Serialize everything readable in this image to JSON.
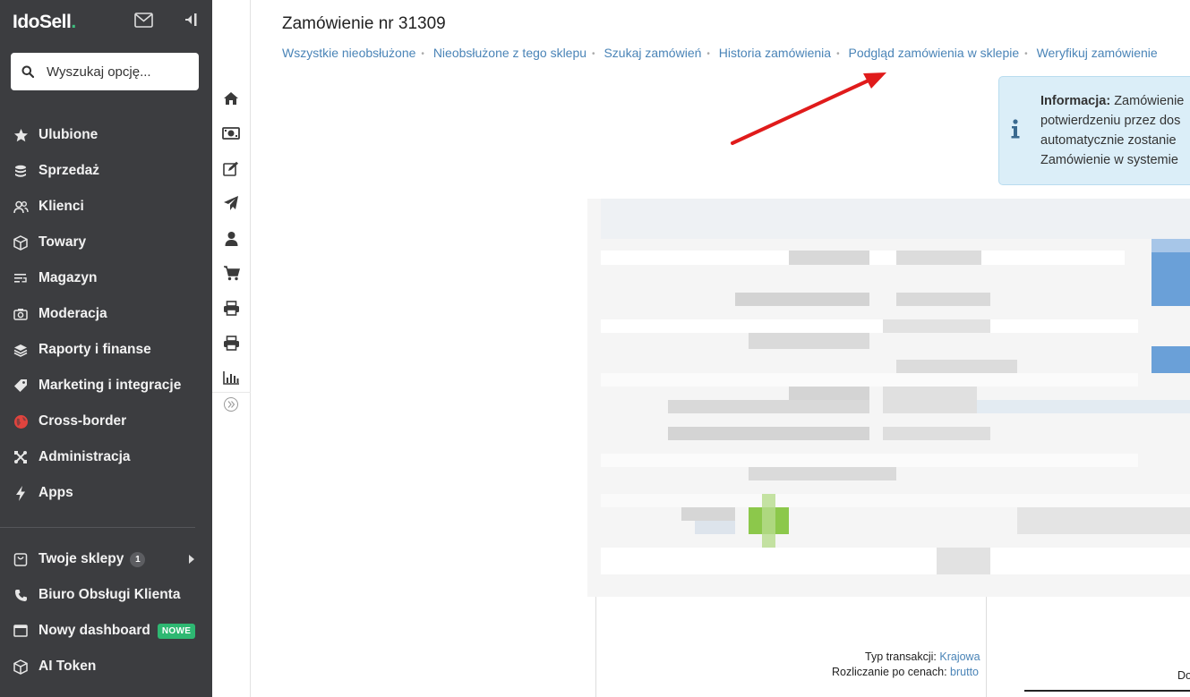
{
  "app": {
    "logo_text_a": "Ido",
    "logo_text_b": "Sell",
    "logo_dot": "."
  },
  "search": {
    "placeholder": "Wyszukaj opcję..."
  },
  "menu": [
    {
      "label": "Ulubione",
      "icon": "star-icon"
    },
    {
      "label": "Sprzedaż",
      "icon": "coins-icon"
    },
    {
      "label": "Klienci",
      "icon": "users-icon"
    },
    {
      "label": "Towary",
      "icon": "box-icon"
    },
    {
      "label": "Magazyn",
      "icon": "warehouse-icon"
    },
    {
      "label": "Moderacja",
      "icon": "camera-icon"
    },
    {
      "label": "Raporty i finanse",
      "icon": "layers-icon"
    },
    {
      "label": "Marketing i integracje",
      "icon": "tag-icon"
    },
    {
      "label": "Cross-border",
      "icon": "globe-icon"
    },
    {
      "label": "Administracja",
      "icon": "tools-icon"
    },
    {
      "label": "Apps",
      "icon": "bolt-icon"
    }
  ],
  "menu2": {
    "shops": {
      "label": "Twoje sklepy",
      "count": "1"
    },
    "support": {
      "label": "Biuro Obsługi Klienta"
    },
    "dashboard": {
      "label": "Nowy dashboard",
      "badge": "NOWE"
    },
    "ai": {
      "label": "AI Token"
    }
  },
  "iconbar": [
    "home-icon",
    "money-icon",
    "edit-icon",
    "send-icon",
    "user-icon",
    "cart-icon",
    "print-icon",
    "print-icon",
    "chart-icon",
    "expand-icon"
  ],
  "page": {
    "title": "Zamówienie nr 31309",
    "links": [
      "Wszystkie nieobsłużone",
      "Nieobsłużone z tego sklepu",
      "Szukaj zamówień",
      "Historia zamówienia",
      "Podgląd zamówienia w sklepie",
      "Weryfikuj zamówienie"
    ]
  },
  "info": {
    "label": "Informacja:",
    "line1": "Zamówienie",
    "line2": "potwierdzeniu przez dos",
    "line3": "automatycznie zostanie",
    "line4": "Zamówienie w systemie"
  },
  "lower": {
    "transaction_label": "Typ transakcji:",
    "transaction_value": "Krajowa",
    "pricing_label": "Rozliczanie po cenach:",
    "pricing_value": "brutto",
    "cut_text": "Do"
  },
  "colors": {
    "sidebar_bg": "#3c3d40",
    "accent_green": "#3fbf7f",
    "link_blue": "#4a84b7",
    "arrow_red": "#e01b1b"
  }
}
